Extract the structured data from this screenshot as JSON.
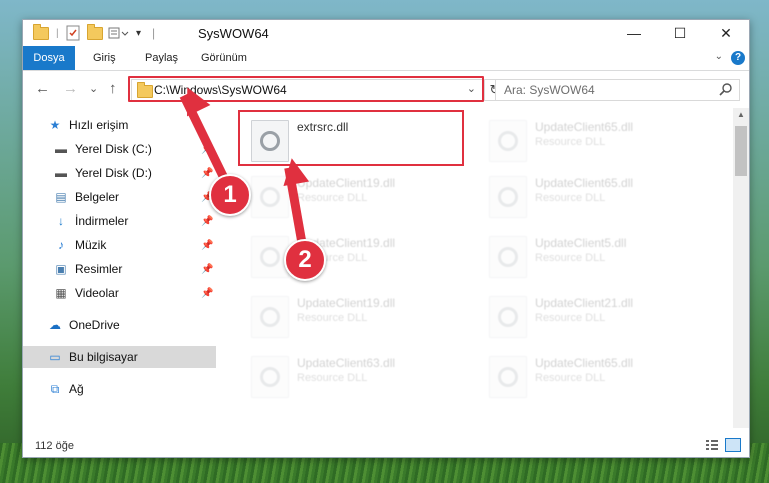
{
  "window": {
    "title": "SysWOW64"
  },
  "controls": {
    "minimize": "—",
    "maximize": "☐",
    "close": "✕"
  },
  "ribbon": {
    "tabs": [
      {
        "label": "Dosya"
      },
      {
        "label": "Giriş"
      },
      {
        "label": "Paylaş"
      },
      {
        "label": "Görünüm"
      }
    ],
    "help": "?"
  },
  "nav": {
    "back": "←",
    "forward": "→",
    "recent": "⌄",
    "up": "↑",
    "address": "C:\\Windows\\SysWOW64",
    "refresh": "↻",
    "search_placeholder": "Ara: SysWOW64"
  },
  "sidebar": {
    "items": [
      {
        "label": "Hızlı erişim",
        "icon": "★"
      },
      {
        "label": "Yerel Disk (C:)",
        "icon": "▬"
      },
      {
        "label": "Yerel Disk (D:)",
        "icon": "▬"
      },
      {
        "label": "Belgeler",
        "icon": "▤"
      },
      {
        "label": "İndirmeler",
        "icon": "↓"
      },
      {
        "label": "Müzik",
        "icon": "♪"
      },
      {
        "label": "Resimler",
        "icon": "▣"
      },
      {
        "label": "Videolar",
        "icon": "▦"
      },
      {
        "label": "OneDrive",
        "icon": "☁"
      },
      {
        "label": "Bu bilgisayar",
        "icon": "▭"
      },
      {
        "label": "Ağ",
        "icon": "⧉"
      }
    ]
  },
  "files": {
    "highlighted": {
      "name": "extrsrc.dll",
      "type": ""
    },
    "items": [
      {
        "name": "UpdateClient19.dll",
        "type": "Resource DLL"
      },
      {
        "name": "UpdateClient19.dll",
        "type": "Resource DLL"
      },
      {
        "name": "UpdateClient19.dll",
        "type": "Resource DLL"
      },
      {
        "name": "UpdateClient63.dll",
        "type": "Resource DLL"
      },
      {
        "name": "UpdateClient65.dll",
        "type": "Resource DLL"
      },
      {
        "name": "UpdateClient65.dll",
        "type": "Resource DLL"
      },
      {
        "name": "UpdateClient5.dll",
        "type": "Resource DLL"
      },
      {
        "name": "UpdateClient21.dll",
        "type": "Resource DLL"
      },
      {
        "name": "UpdateClient65.dll",
        "type": "Resource DLL"
      }
    ]
  },
  "status": {
    "count": "112 öğe"
  },
  "annotations": {
    "step1": "1",
    "step2": "2"
  },
  "colors": {
    "accent": "#1979ca",
    "highlight": "#e0303f"
  }
}
